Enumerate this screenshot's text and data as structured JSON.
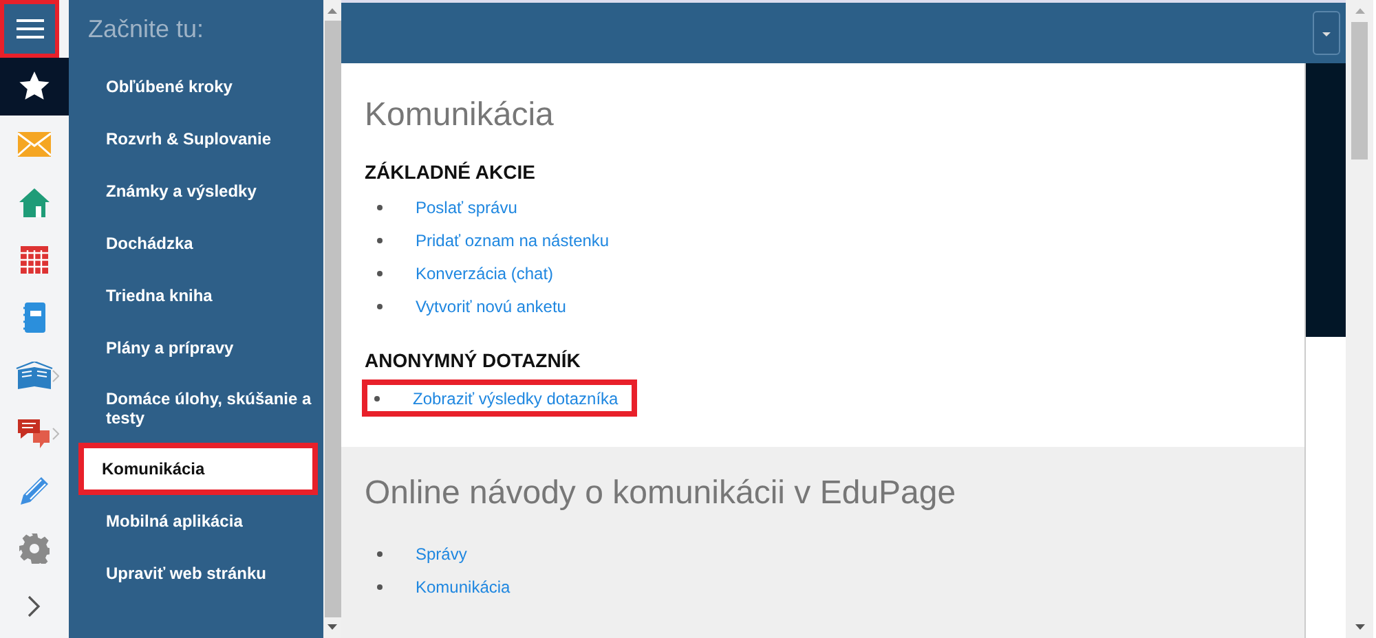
{
  "rail": {
    "menu_button": {
      "highlighted": true
    },
    "icons": [
      {
        "kind": "star",
        "selected": true,
        "submenu": false
      },
      {
        "kind": "mail",
        "selected": false,
        "submenu": false
      },
      {
        "kind": "home",
        "selected": false,
        "submenu": false
      },
      {
        "kind": "calendar",
        "selected": false,
        "submenu": false
      },
      {
        "kind": "notebook",
        "selected": false,
        "submenu": false
      },
      {
        "kind": "book",
        "selected": false,
        "submenu": true
      },
      {
        "kind": "chat",
        "selected": false,
        "submenu": true
      },
      {
        "kind": "pen",
        "selected": false,
        "submenu": false
      },
      {
        "kind": "gear",
        "selected": false,
        "submenu": false
      },
      {
        "kind": "expand",
        "selected": false,
        "submenu": false
      }
    ]
  },
  "menu": {
    "title": "Začnite tu:",
    "items": [
      {
        "label": "Obľúbené kroky",
        "selected": false,
        "highlighted": false
      },
      {
        "label": "Rozvrh & Suplovanie",
        "selected": false,
        "highlighted": false
      },
      {
        "label": "Známky a výsledky",
        "selected": false,
        "highlighted": false
      },
      {
        "label": "Dochádzka",
        "selected": false,
        "highlighted": false
      },
      {
        "label": "Triedna kniha",
        "selected": false,
        "highlighted": false
      },
      {
        "label": "Plány a prípravy",
        "selected": false,
        "highlighted": false
      },
      {
        "label": "Domáce úlohy, skúšanie a testy",
        "selected": false,
        "highlighted": false
      },
      {
        "label": "Komunikácia",
        "selected": true,
        "highlighted": true
      },
      {
        "label": "Mobilná aplikácia",
        "selected": false,
        "highlighted": false
      },
      {
        "label": "Upraviť web stránku",
        "selected": false,
        "highlighted": false
      }
    ]
  },
  "panel": {
    "title": "Komunikácia",
    "sections": [
      {
        "heading": "ZÁKLADNÉ AKCIE",
        "links": [
          {
            "text": "Poslať správu",
            "highlighted": false
          },
          {
            "text": "Pridať oznam na nástenku",
            "highlighted": false
          },
          {
            "text": "Konverzácia (chat)",
            "highlighted": false
          },
          {
            "text": "Vytvoriť novú anketu",
            "highlighted": false
          }
        ]
      },
      {
        "heading": "ANONYMNÝ DOTAZNÍK",
        "links": [
          {
            "text": "Zobraziť výsledky dotazníka",
            "highlighted": true
          }
        ]
      }
    ],
    "tutorials": {
      "title": "Online návody o komunikácii v EduPage",
      "links": [
        {
          "text": "Správy",
          "highlighted": false
        },
        {
          "text": "Komunikácia",
          "highlighted": false
        }
      ]
    }
  }
}
